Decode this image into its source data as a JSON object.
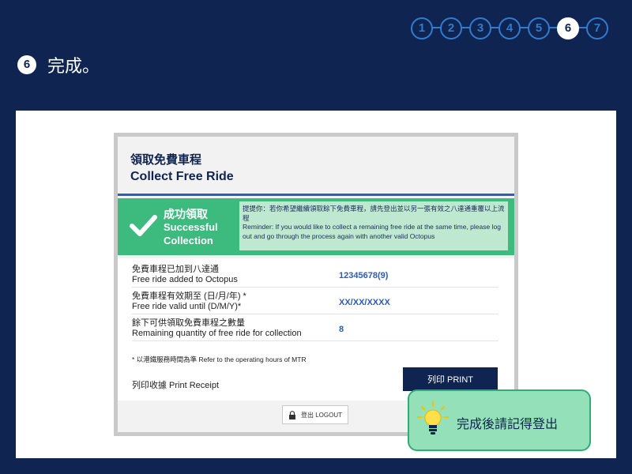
{
  "steps": {
    "items": [
      "1",
      "2",
      "3",
      "4",
      "5",
      "6",
      "7"
    ],
    "current": "6"
  },
  "page": {
    "step_num": "6",
    "title": "完成。"
  },
  "card": {
    "title_zh": "領取免費車程",
    "title_en": "Collect Free Ride",
    "status_zh": "成功領取",
    "status_en": "Successful Collection",
    "reminder_zh": "提提你：若你希望繼續領取餘下免費車程，請先登出並以另一張有效之八達通重覆以上流程",
    "reminder_en": "Reminder: If you would like to collect a remaining free ride at the same time, please log out and go through the process again with another valid Octopus",
    "rows": [
      {
        "label_zh": "免費車程已加到八達通",
        "label_en": "Free ride added to Octopus",
        "value": "12345678(9)"
      },
      {
        "label_zh": "免費車程有效期至 (日/月/年) *",
        "label_en": "Free ride valid until (D/M/Y)*",
        "value": "XX/XX/XXXX"
      },
      {
        "label_zh": "餘下可供領取免費車程之數量",
        "label_en": "Remaining quantity of free ride for collection",
        "value": "8"
      }
    ],
    "note": "* 以港鐵服務時間為準 Refer to the operating hours of MTR",
    "print_label": "列印收據 Print Receipt",
    "print_button": "列印 PRINT",
    "logout_button": "登出 LOGOUT"
  },
  "tip": {
    "text": "完成後請記得登出",
    "icon": "lightbulb-icon"
  },
  "colors": {
    "navy": "#0f2450",
    "green": "#3dba7e",
    "link_blue": "#2a5bbd"
  }
}
